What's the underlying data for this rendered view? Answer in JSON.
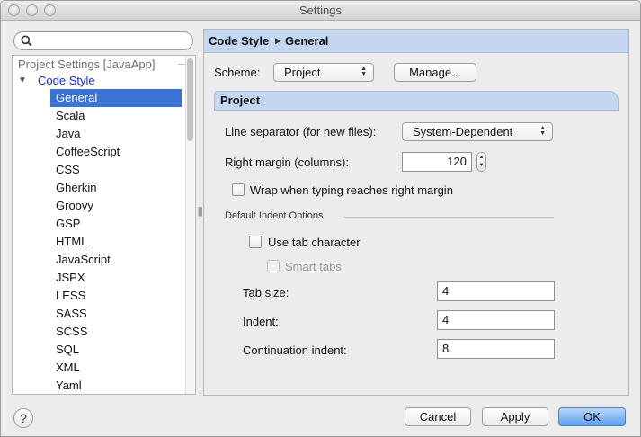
{
  "window": {
    "title": "Settings"
  },
  "search": {
    "value": ""
  },
  "tree": {
    "group_label": "Project Settings [JavaApp]",
    "node": "Code Style",
    "items": [
      "General",
      "Scala",
      "Java",
      "CoffeeScript",
      "CSS",
      "Gherkin",
      "Groovy",
      "GSP",
      "HTML",
      "JavaScript",
      "JSPX",
      "LESS",
      "SASS",
      "SCSS",
      "SQL",
      "XML",
      "Yaml"
    ],
    "selected_index": 0
  },
  "breadcrumb": {
    "parent": "Code Style",
    "current": "General"
  },
  "scheme": {
    "label": "Scheme:",
    "value": "Project",
    "manage_label": "Manage..."
  },
  "project": {
    "section_title": "Project",
    "line_separator_label": "Line separator (for new files):",
    "line_separator_value": "System-Dependent",
    "right_margin_label": "Right margin (columns):",
    "right_margin_value": "120",
    "wrap_label": "Wrap when typing reaches right margin",
    "wrap_checked": false
  },
  "indent": {
    "heading": "Default Indent Options",
    "use_tab_label": "Use tab character",
    "use_tab_checked": false,
    "smart_tabs_label": "Smart tabs",
    "smart_tabs_checked": false,
    "tab_size_label": "Tab size:",
    "tab_size_value": "4",
    "indent_label": "Indent:",
    "indent_value": "4",
    "continuation_label": "Continuation indent:",
    "continuation_value": "8"
  },
  "buttons": {
    "help": "?",
    "cancel": "Cancel",
    "apply": "Apply",
    "ok": "OK"
  }
}
